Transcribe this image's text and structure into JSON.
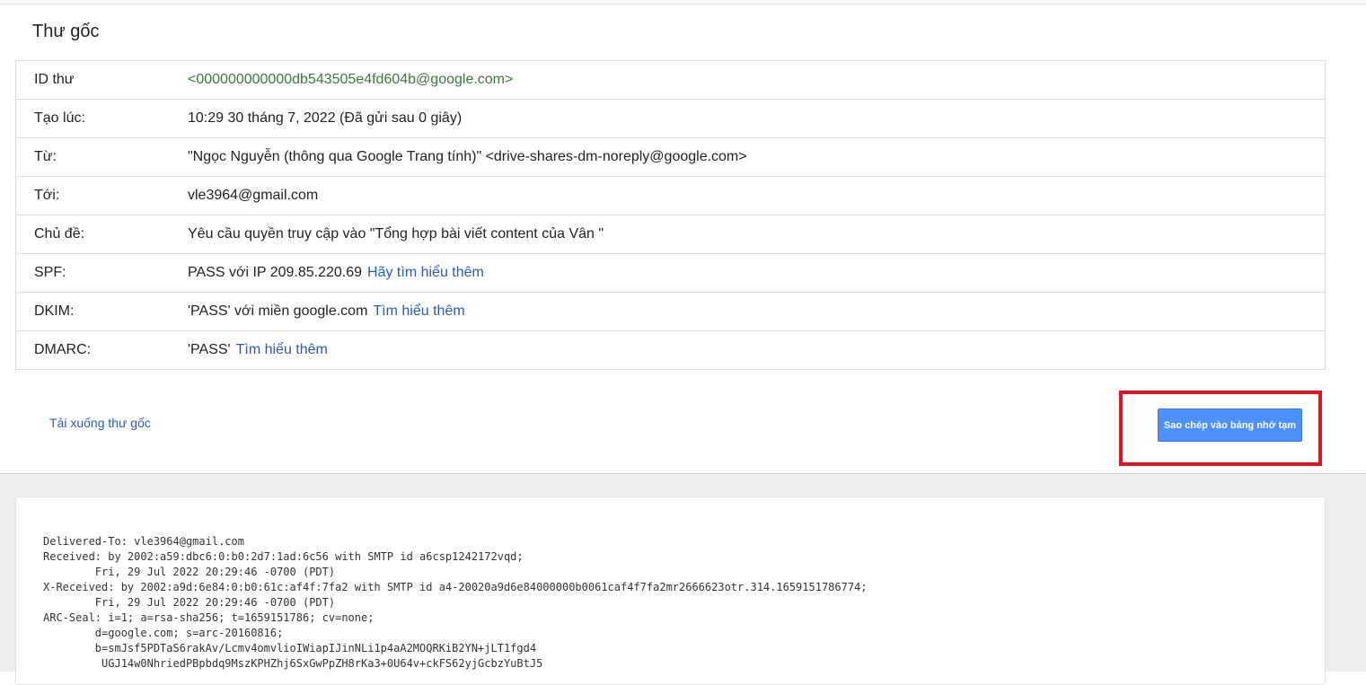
{
  "header": {
    "title": "Thư gốc"
  },
  "details": [
    {
      "label": "ID thư",
      "value": "<000000000000db543505e4fd604b@google.com>",
      "link": ""
    },
    {
      "label": "Tạo lúc:",
      "value": "10:29 30 tháng 7, 2022 (Đã gửi sau 0 giây)",
      "link": ""
    },
    {
      "label": "Từ:",
      "value": "\"Ngọc Nguyễn (thông qua Google Trang tính)\" <drive-shares-dm-noreply@google.com>",
      "link": ""
    },
    {
      "label": "Tới:",
      "value": "vle3964@gmail.com",
      "link": ""
    },
    {
      "label": "Chủ đề:",
      "value": "Yêu cầu quyền truy cập vào \"Tổng hợp bài viết content của Vân \"",
      "link": ""
    },
    {
      "label": "SPF:",
      "value": "PASS với IP 209.85.220.69",
      "link": "Hãy tìm hiểu thêm"
    },
    {
      "label": "DKIM:",
      "value": "'PASS' với miền google.com",
      "link": "Tìm hiểu thêm"
    },
    {
      "label": "DMARC:",
      "value": "'PASS'",
      "link": "Tìm hiểu thêm"
    }
  ],
  "actions": {
    "download_label": "Tải xuống thư gốc",
    "copy_label": "Sao chép vào bảng nhớ tạm"
  },
  "raw_message": "Delivered-To: vle3964@gmail.com\nReceived: by 2002:a59:dbc6:0:b0:2d7:1ad:6c56 with SMTP id a6csp1242172vqd;\n        Fri, 29 Jul 2022 20:29:46 -0700 (PDT)\nX-Received: by 2002:a9d:6e84:0:b0:61c:af4f:7fa2 with SMTP id a4-20020a9d6e84000000b0061caf4f7fa2mr2666623otr.314.1659151786774;\n        Fri, 29 Jul 2022 20:29:46 -0700 (PDT)\nARC-Seal: i=1; a=rsa-sha256; t=1659151786; cv=none;\n        d=google.com; s=arc-20160816;\n        b=smJsf5PDTaS6rakAv/Lcmv4omvlioIWiapIJinNLi1p4aA2MOQRKiB2YN+jLT1fgd4\n         UGJ14w0NhriedPBpbdq9MszKPHZhj6SxGwPpZH8rKa3+0U64v+ckFS62yjGcbzYuBtJ5",
  "colors": {
    "link": "#2a5db0",
    "id_green": "#3b7a3b",
    "button_bg": "#4d90fe",
    "highlight": "#e0141e"
  }
}
